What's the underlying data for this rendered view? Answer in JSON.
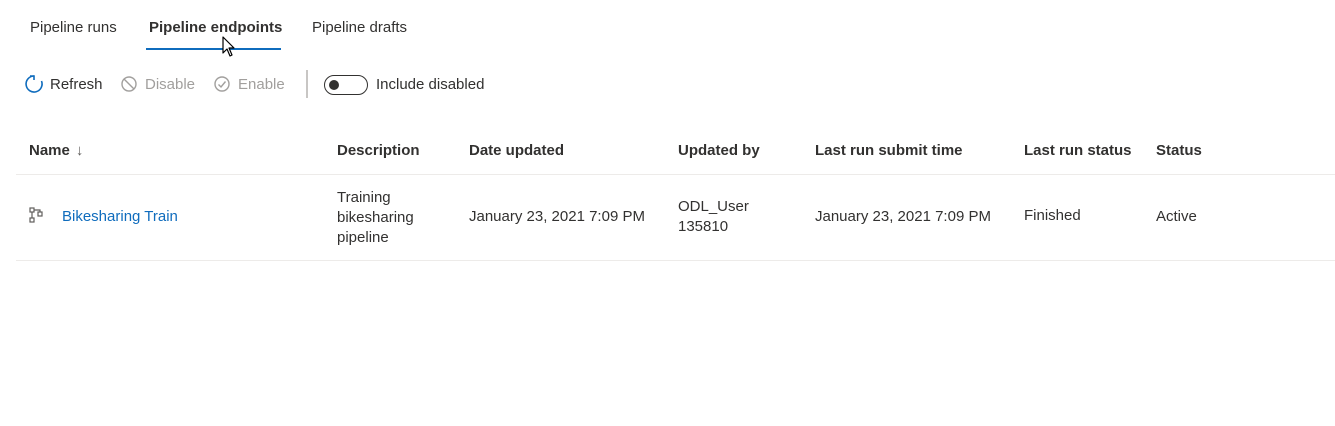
{
  "tabs": [
    {
      "label": "Pipeline runs"
    },
    {
      "label": "Pipeline endpoints"
    },
    {
      "label": "Pipeline drafts"
    }
  ],
  "toolbar": {
    "refresh_label": "Refresh",
    "disable_label": "Disable",
    "enable_label": "Enable",
    "include_disabled_label": "Include disabled",
    "include_disabled_on": false
  },
  "table": {
    "columns": [
      "Name",
      "Description",
      "Date updated",
      "Updated by",
      "Last run submit time",
      "Last run status",
      "Status"
    ],
    "sort_indicator": "↓",
    "rows": [
      {
        "name": "Bikesharing Train",
        "description_lines": [
          "Training",
          "bikesharing",
          "pipeline"
        ],
        "date_updated": "January 23, 2021 7:09 PM",
        "updated_by_lines": [
          "ODL_User",
          "135810"
        ],
        "last_run_submit_time": "January 23, 2021 7:09 PM",
        "last_run_status": "Finished",
        "status": "Active"
      }
    ]
  },
  "colors": {
    "accent": "#0f6cbd",
    "text": "#323130",
    "disabled": "#a19f9d"
  }
}
